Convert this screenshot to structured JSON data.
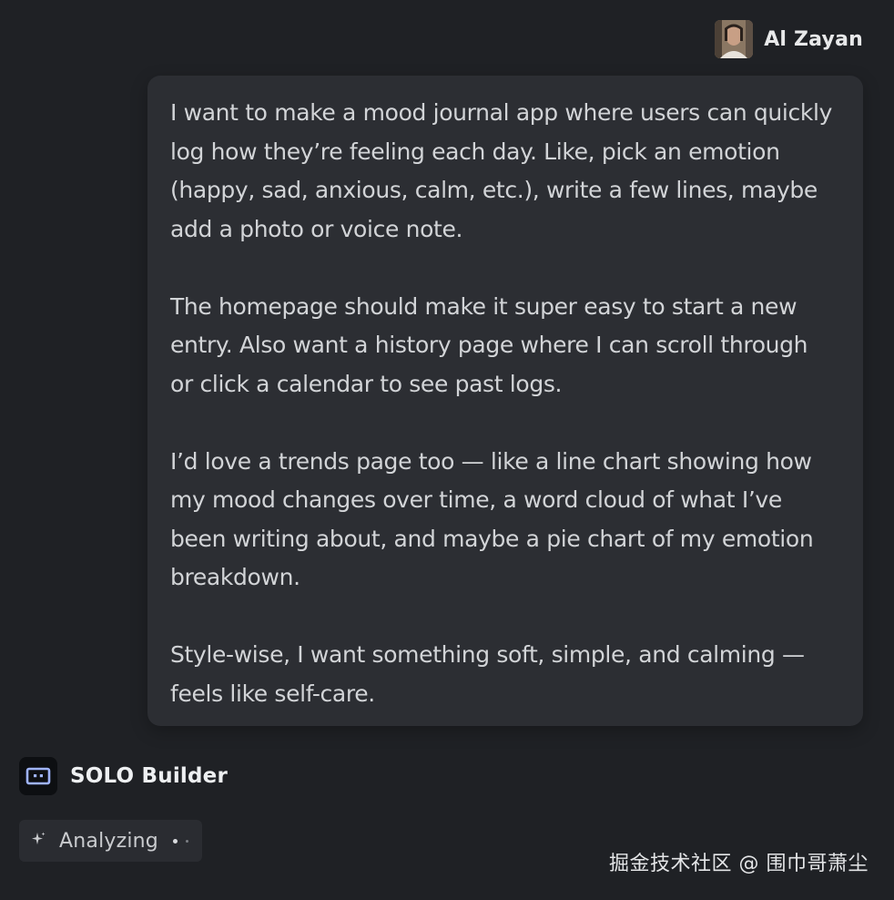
{
  "user": {
    "name": "Al Zayan"
  },
  "message": {
    "paragraphs": [
      "I want to make a mood journal app where users can quickly log how they’re feeling each day. Like, pick an emotion (happy, sad, anxious, calm, etc.), write a few lines, maybe add a photo or voice note.",
      "The homepage should make it super easy to start a new entry. Also want a history page where I can scroll through or click a calendar to see past logs.",
      "I’d love a trends page too — like a line chart showing how my mood changes over time, a word cloud of what I’ve been writing about, and maybe a pie chart of my emotion breakdown.",
      "Style-wise, I want something soft, simple, and calming — feels like self-care."
    ]
  },
  "assistant": {
    "name": "SOLO Builder",
    "logo_icon": "robot-face-icon",
    "status": "Analyzing",
    "status_icon": "sparkle-icon"
  },
  "watermark": {
    "text": "掘金技术社区 @ 围巾哥萧尘"
  },
  "colors": {
    "background": "#1f2125",
    "bubble": "#2c2e33",
    "text": "#d2d4d7",
    "chip": "#2a2c31"
  }
}
